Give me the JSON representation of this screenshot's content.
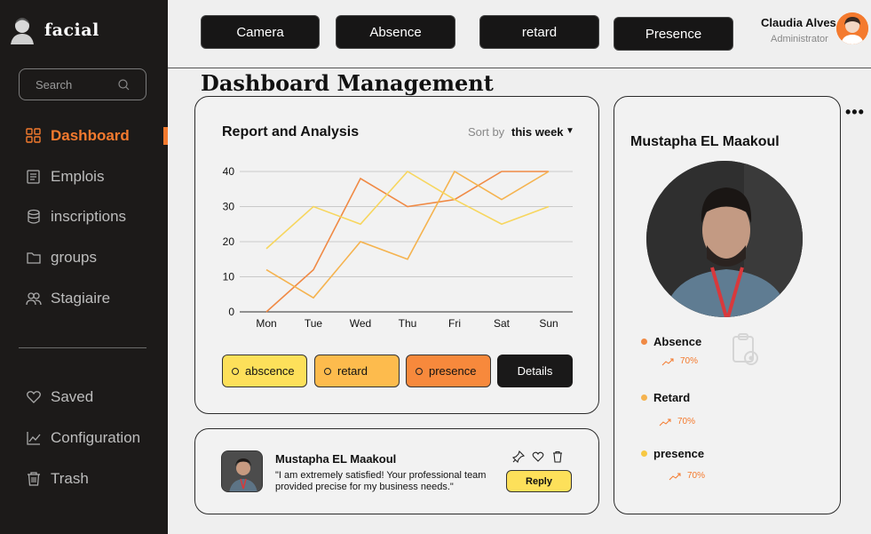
{
  "app": {
    "name": "facial"
  },
  "sidebar": {
    "search_placeholder": "Search",
    "items": [
      {
        "label": "Dashboard",
        "icon": "grid-icon",
        "active": true
      },
      {
        "label": "Emplois",
        "icon": "notebook-icon"
      },
      {
        "label": "inscriptions",
        "icon": "database-icon"
      },
      {
        "label": "groups",
        "icon": "folder-icon"
      },
      {
        "label": "Stagiaire",
        "icon": "users-icon"
      }
    ],
    "bottom_items": [
      {
        "label": "Saved",
        "icon": "heart-icon"
      },
      {
        "label": "Configuration",
        "icon": "chart-icon"
      },
      {
        "label": "Trash",
        "icon": "trash-icon"
      }
    ]
  },
  "topbar": {
    "buttons": [
      "Camera",
      "Absence",
      "retard",
      "Presence"
    ],
    "user_name": "Claudia Alves",
    "user_role": "Administrator"
  },
  "page_title": "Dashboard Management",
  "report": {
    "title": "Report and Analysis",
    "sort_label": "Sort by",
    "sort_value": "this week",
    "legend": [
      {
        "label": "abscence",
        "color": "#fde05a"
      },
      {
        "label": "retard",
        "color": "#fdbb4d"
      },
      {
        "label": "presence",
        "color": "#f7893c"
      }
    ],
    "details_label": "Details"
  },
  "chart_data": {
    "type": "line",
    "categories": [
      "Mon",
      "Tue",
      "Wed",
      "Thu",
      "Fri",
      "Sat",
      "Sun"
    ],
    "ylim": [
      0,
      40
    ],
    "yticks": [
      0,
      10,
      20,
      30,
      40
    ],
    "grid": true,
    "series": [
      {
        "values": [
          0,
          12,
          38,
          30,
          32,
          40,
          40
        ],
        "color": "#f08a45"
      },
      {
        "values": [
          12,
          4,
          20,
          15,
          40,
          32,
          40
        ],
        "color": "#f5b34f"
      },
      {
        "values": [
          18,
          30,
          25,
          40,
          32,
          25,
          30
        ],
        "color": "#f7d65e"
      }
    ]
  },
  "comment": {
    "name": "Mustapha EL Maakoul",
    "text": "\"I am extremely satisfied! Your professional team provided precise for my business needs.\"",
    "reply_label": "Reply"
  },
  "profile": {
    "name": "Mustapha  EL Maakoul",
    "stats": [
      {
        "label": "Absence",
        "value": "70%",
        "dot": "#f08a45"
      },
      {
        "label": "Retard",
        "value": "70%",
        "dot": "#f5b34f"
      },
      {
        "label": "presence",
        "value": "70%",
        "dot": "#f7c843"
      }
    ]
  }
}
